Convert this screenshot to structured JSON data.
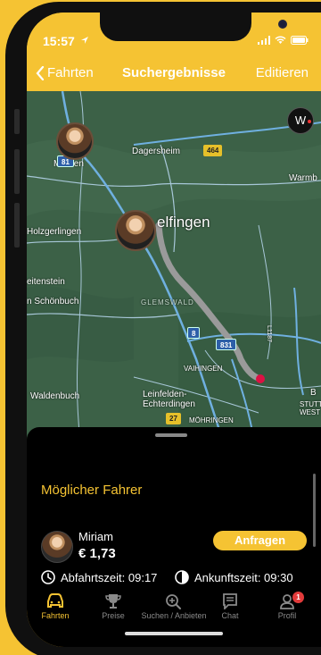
{
  "status_bar": {
    "time": "15:57"
  },
  "nav": {
    "back_label": "Fahrten",
    "title": "Suchergebnisse",
    "edit_label": "Editieren"
  },
  "map": {
    "compass_label": "W",
    "places": {
      "dagersheim": "Dagersheim",
      "mauren": "Mauren",
      "warmbronn": "Warmb",
      "holzgerlingen": "Holzgerlingen",
      "boeblingen": "elfingen",
      "weilimschoenbuch": "eitenstein",
      "schoenbuch": "n Schönbuch",
      "glemswald": "GLEMSWALD",
      "vaihingen": "VAIHINGEN",
      "waldenbuch": "Waldenbuch",
      "leinfelden": "Leinfelden-\nEchterdingen",
      "moehringen": "MÖHRINGEN",
      "stuttgart": "STUTTGA\nWEST",
      "l1187": "L1187",
      "b": "B"
    },
    "road_shields": [
      "81",
      "464",
      "8",
      "831",
      "27"
    ]
  },
  "sheet": {
    "title": "Möglicher Fahrer",
    "driver": {
      "name": "Miriam",
      "price": "€ 1,73",
      "request_label": "Anfragen",
      "departure": "Abfahrtszeit: 09:17",
      "arrival": "Ankunftszeit: 09:30"
    }
  },
  "tabs": [
    {
      "label": "Fahrten",
      "icon": "car-icon",
      "active": true
    },
    {
      "label": "Preise",
      "icon": "trophy-icon",
      "active": false
    },
    {
      "label": "Suchen / Anbieten",
      "icon": "search-plus-icon",
      "active": false
    },
    {
      "label": "Chat",
      "icon": "chat-icon",
      "active": false
    },
    {
      "label": "Profil",
      "icon": "profile-icon",
      "active": false,
      "badge": "1"
    }
  ],
  "colors": {
    "accent": "#f5c333",
    "map_green": "#3c6147",
    "sheet_bg": "#000000",
    "badge": "#e23b3b"
  }
}
